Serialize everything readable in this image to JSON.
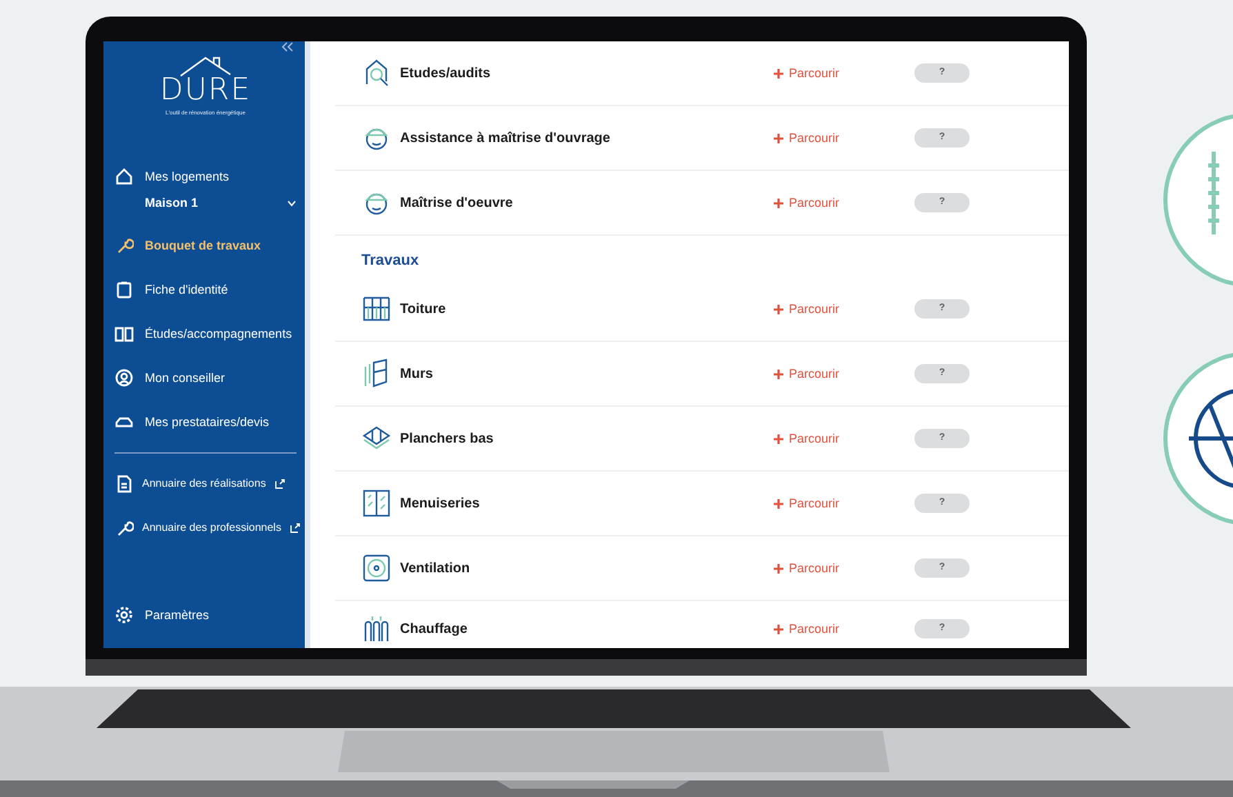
{
  "sidebar": {
    "logo": {
      "name": "DURE",
      "tagline": "L'outil de rénovation énergétique"
    },
    "nav": [
      {
        "kind": "link",
        "label": "Mes logements",
        "selected": false,
        "external": false
      },
      {
        "kind": "select",
        "value": "Maison 1"
      },
      {
        "kind": "link",
        "label": "Bouquet de travaux",
        "selected": true,
        "external": false
      },
      {
        "kind": "link",
        "label": "Fiche d'identité",
        "selected": false,
        "external": false
      },
      {
        "kind": "link",
        "label": "Études/accompagnements",
        "selected": false,
        "external": false
      },
      {
        "kind": "link",
        "label": "Mon conseiller",
        "selected": false,
        "external": false
      },
      {
        "kind": "link",
        "label": "Mes prestataires/devis",
        "selected": false,
        "external": false
      },
      {
        "kind": "divider"
      },
      {
        "kind": "link",
        "label": "Annuaire des réalisations",
        "selected": false,
        "external": true
      },
      {
        "kind": "link",
        "label": "Annuaire des professionnels",
        "selected": false,
        "external": true
      },
      {
        "kind": "footer",
        "label": "Paramètres",
        "selected": false,
        "external": false
      }
    ]
  },
  "content": [
    {
      "kind": "row",
      "label": "Etudes/audits",
      "action": "Parcourir",
      "badge": "?"
    },
    {
      "kind": "row",
      "label": "Assistance à maîtrise d'ouvrage",
      "action": "Parcourir",
      "badge": "?"
    },
    {
      "kind": "row",
      "label": "Maîtrise d'oeuvre",
      "action": "Parcourir",
      "badge": "?"
    },
    {
      "kind": "heading",
      "label": "Travaux"
    },
    {
      "kind": "row",
      "label": "Toiture",
      "action": "Parcourir",
      "badge": "?"
    },
    {
      "kind": "row",
      "label": "Murs",
      "action": "Parcourir",
      "badge": "?"
    },
    {
      "kind": "row",
      "label": "Planchers bas",
      "action": "Parcourir",
      "badge": "?"
    },
    {
      "kind": "row",
      "label": "Menuiseries",
      "action": "Parcourir",
      "badge": "?"
    },
    {
      "kind": "row",
      "label": "Ventilation",
      "action": "Parcourir",
      "badge": "?"
    },
    {
      "kind": "row",
      "label": "Chauffage",
      "action": "Parcourir",
      "badge": "?"
    }
  ]
}
